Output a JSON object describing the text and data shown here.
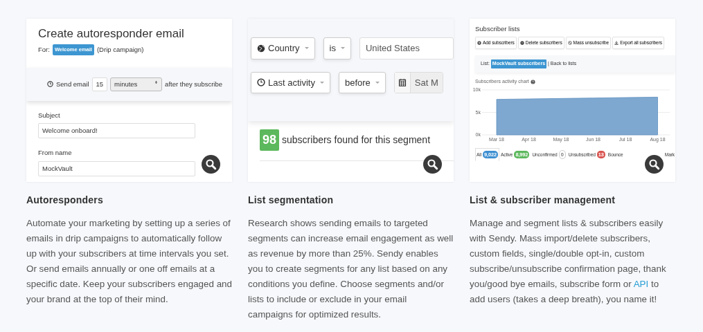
{
  "features": [
    {
      "kind": "autoresponder",
      "title": "Autoresponders",
      "description": [
        {
          "text": "Automate your marketing by setting up a series of emails in drip campaigns to automatically follow up with your subscribers at time intervals you set. Or send emails annually or one off emails at a specific date. Keep your subscribers engaged and your brand at the top of their mind."
        }
      ],
      "screen": {
        "heading": "Create autoresponder email",
        "for_label": "For:",
        "campaign_badge": "Welcome email",
        "campaign_type": "(Drip campaign)",
        "send_label": "Send email",
        "send_amount": "15",
        "send_unit": "minutes",
        "send_suffix": "after they subscribe",
        "fields": [
          {
            "label": "Subject",
            "value": "Welcome onboard!"
          },
          {
            "label": "From name",
            "value": "MockVault"
          }
        ]
      }
    },
    {
      "kind": "segmentation",
      "title": "List segmentation",
      "description": [
        {
          "text": "Research shows sending emails to targeted segments can increase email engagement as well as revenue by more than 25%. Sendy enables you to create segments for any list based on any conditions you define. Choose segments and/or lists to include or exclude in your email campaigns for optimized results."
        }
      ],
      "screen": {
        "rules": [
          {
            "field": "Country",
            "operator": "is",
            "value": "United States",
            "kind": "text"
          },
          {
            "field": "Last activity",
            "operator": "before",
            "value": "Sat M",
            "kind": "date"
          }
        ],
        "count": "98",
        "count_label": "subscribers found for this segment"
      }
    },
    {
      "kind": "lists",
      "title": "List & subscriber management",
      "description": [
        {
          "text": "Manage and segment lists & subscribers easily with Sendy. Mass import/delete subscribers, custom fields, single/double opt-in, custom subscribe/unsubscribe confirmation page, thank you/good bye emails, subscribe form or "
        },
        {
          "kind": "link",
          "text": "API"
        },
        {
          "text": " to add users (takes a deep breath), you name it!"
        }
      ],
      "screen": {
        "heading": "Subscriber lists",
        "buttons": [
          {
            "label": "Add subscribers"
          },
          {
            "label": "Delete subscribers"
          },
          {
            "label": "Mass unsubscribe"
          },
          {
            "label": "Export all subscribers"
          }
        ],
        "list_label": "List:",
        "list_badge": "MockVault subscribers",
        "back_link": "| Back to lists",
        "chart_title": "Subscribers activity chart",
        "chart_data": {
          "type": "area",
          "categories": [
            "Mar 18",
            "Apr 18",
            "May 18",
            "Jun 18",
            "Jul 18",
            "Aug 18"
          ],
          "series": [
            {
              "color": "#7ea8cf",
              "values": [
                7900,
                8000,
                8100,
                8200,
                8300,
                8400
              ]
            }
          ],
          "ylim": [
            0,
            10000
          ],
          "yticks": [
            {
              "value": 0,
              "label": "0k"
            },
            {
              "value": 5000,
              "label": "5k"
            },
            {
              "value": 10000,
              "label": "10k"
            }
          ]
        },
        "tabs": [
          {
            "label": "All",
            "count": "9,022",
            "color": "#3d8fd1",
            "selected": true
          },
          {
            "label": "Active",
            "count": "8,992",
            "color": "#5cb85c",
            "selected": false
          },
          {
            "label": "Unconfirmed",
            "count": "0",
            "color": "#ffffff",
            "selected": false
          },
          {
            "label": "Unsubscribed",
            "count": "13",
            "color": "#d9534f",
            "selected": false
          },
          {
            "label": "Bounce",
            "selected": false
          },
          {
            "label": "Mark",
            "selected": false
          }
        ]
      }
    }
  ]
}
